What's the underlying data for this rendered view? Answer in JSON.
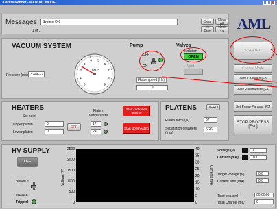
{
  "window": {
    "title": "AMH04 Bender - MANUAL MODE"
  },
  "messages": {
    "label": "Messages",
    "text": "System OK",
    "page": "1 of 1",
    "clear_label": "Clear",
    "clear_all_label": "Clear All",
    "prev_label": "<< Prev",
    "next_label": "Next >>"
  },
  "logo": {
    "text": "AML"
  },
  "vacuum": {
    "title": "VACUUM SYSTEM",
    "pressure_label": "Pressure (mbar)",
    "pressure_value": "3.48E+2",
    "gauge_label": "log P",
    "gauge_ticks": [
      "0",
      "1",
      "2",
      "3",
      "4",
      "5",
      "6",
      "7",
      "8",
      "9"
    ],
    "gauge_log_p": 2.5
  },
  "pump": {
    "title": "Pump",
    "off_label": "OFF",
    "on_label": "ON",
    "rotor_label": "Rotor speed (Hz)",
    "rotor_value": "0"
  },
  "valves": {
    "title": "Valves",
    "isolation_label": "Isolation",
    "isolation_state": "OPEN",
    "vent_label": "Vent"
  },
  "side_buttons": {
    "started": "STARTED",
    "change_mode": "Change Mode",
    "view_changes": "View Changes [F3]",
    "view_parameters": "View Parameters [F4]",
    "set_pump_params": "Set Pump Params [F5]",
    "stop_process": "STOP PROCESS [Esc]"
  },
  "heaters": {
    "title": "HEATERS",
    "set_point_label": "Set point",
    "platen_temp_label": "Platen Temperature",
    "upper_label": "Upper platen",
    "lower_label": "Lower platen",
    "upper_set": "0",
    "lower_set": "0",
    "upper_temp": "17",
    "lower_temp": "24",
    "off_label": "OFF",
    "start_controlled": "Start controlled heating",
    "start_slow": "Start slow heating"
  },
  "platens": {
    "title": "PLATENS",
    "zero_label": "ZERO",
    "force_label": "Platen force (N)",
    "force_value": "67",
    "separation_label": "Separation of wafers (mm)",
    "separation_value": "6.26"
  },
  "hv": {
    "title": "HV SUPPLY",
    "off_label": "OFF",
    "disable_label": "DISABLE",
    "enable_label": "ENABLE",
    "tripped_label": "Tripped",
    "voltage_label": "Voltage (V)",
    "voltage_value": "0",
    "current_label": "Current (mA)",
    "current_value": "0.00",
    "target_voltage_label": "Target voltage (V)",
    "target_voltage_value": "0.0",
    "current_limit_label": "Current limit (mA)",
    "current_limit_value": "0.0",
    "time_elapsed_label": "Time elapsed",
    "time_elapsed_value": "00:00:00",
    "total_charge_label": "Total Charge (mC)",
    "total_charge_value": "0"
  },
  "chart_data": {
    "type": "line",
    "ylabel": "Voltage (V)",
    "y2label": "Current (mA)",
    "ylim": [
      0,
      2500
    ],
    "y2lim": [
      0,
      40
    ],
    "yticks": [
      "2500",
      "2000",
      "1500",
      "1000",
      "500",
      "0"
    ],
    "y2ticks": [
      "40",
      "35",
      "30",
      "25",
      "20",
      "15",
      "10",
      "5",
      "0"
    ],
    "series": [],
    "background": "#000000"
  },
  "colors": {
    "red": "#e41d1d",
    "green": "#3acd3a",
    "title_bar": "#1f5fd0"
  }
}
